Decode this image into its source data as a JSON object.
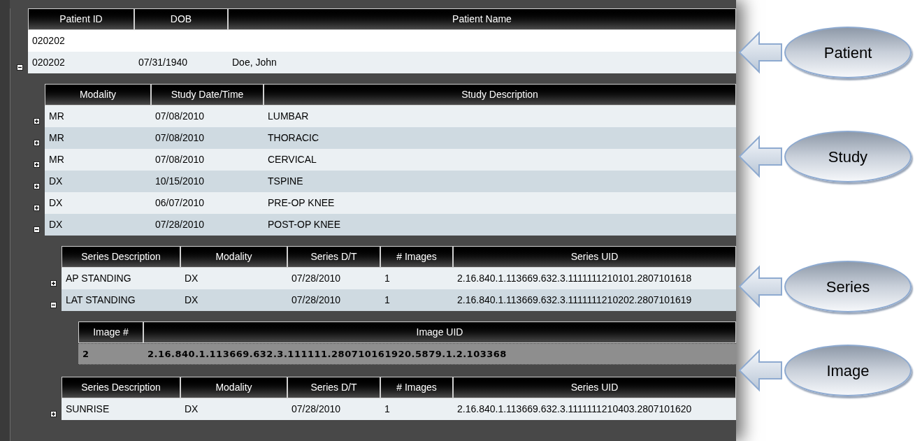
{
  "patients": {
    "kind": "patient",
    "columns": [
      "Patient ID",
      "DOB",
      "Patient Name"
    ],
    "filter_row": [
      "020202"
    ],
    "rows": [
      {
        "cells": [
          "020202",
          "07/31/1940",
          "Doe, John"
        ],
        "expanded": true,
        "selected": false,
        "children": [
          {
            "kind": "study",
            "columns": [
              "Modality",
              "Study Date/Time",
              "Study Description"
            ],
            "rows": [
              {
                "cells": [
                  "MR",
                  "07/08/2010",
                  "LUMBAR"
                ],
                "expanded": false,
                "selected": false
              },
              {
                "cells": [
                  "MR",
                  "07/08/2010",
                  "THORACIC"
                ],
                "expanded": false,
                "selected": false
              },
              {
                "cells": [
                  "MR",
                  "07/08/2010",
                  "CERVICAL"
                ],
                "expanded": false,
                "selected": false
              },
              {
                "cells": [
                  "DX",
                  "10/15/2010",
                  "TSPINE"
                ],
                "expanded": false,
                "selected": false
              },
              {
                "cells": [
                  "DX",
                  "06/07/2010",
                  "PRE-OP KNEE"
                ],
                "expanded": false,
                "selected": false
              },
              {
                "cells": [
                  "DX",
                  "07/28/2010",
                  "POST-OP KNEE"
                ],
                "expanded": true,
                "selected": false,
                "children": [
                  {
                    "kind": "series",
                    "columns": [
                      "Series Description",
                      "Modality",
                      "Series D/T",
                      "# Images",
                      "Series UID"
                    ],
                    "rows": [
                      {
                        "cells": [
                          "AP STANDING",
                          "DX",
                          "07/28/2010",
                          "1",
                          "2.16.840.1.113669.632.3.1111111210101.2807101618"
                        ],
                        "expanded": false,
                        "selected": false
                      },
                      {
                        "cells": [
                          "LAT STANDING",
                          "DX",
                          "07/28/2010",
                          "1",
                          "2.16.840.1.113669.632.3.1111111210202.2807101619"
                        ],
                        "expanded": true,
                        "selected": false,
                        "children": [
                          {
                            "kind": "image",
                            "columns": [
                              "Image #",
                              "Image UID"
                            ],
                            "rows": [
                              {
                                "cells": [
                                  "2",
                                  "2.16.840.1.113669.632.3.111111.280710161920.5879.1.2.103368"
                                ],
                                "selected": true
                              }
                            ]
                          }
                        ]
                      }
                    ]
                  },
                  {
                    "kind": "series",
                    "columns": [
                      "Series Description",
                      "Modality",
                      "Series D/T",
                      "# Images",
                      "Series UID"
                    ],
                    "rows": [
                      {
                        "cells": [
                          "SUNRISE",
                          "DX",
                          "07/28/2010",
                          "1",
                          "2.16.840.1.113669.632.3.1111111210403.2807101620"
                        ],
                        "expanded": false,
                        "selected": false
                      }
                    ]
                  }
                ]
              }
            ]
          }
        ]
      }
    ]
  },
  "callouts": [
    {
      "label": "Patient"
    },
    {
      "label": "Study"
    },
    {
      "label": "Series"
    },
    {
      "label": "Image"
    }
  ]
}
